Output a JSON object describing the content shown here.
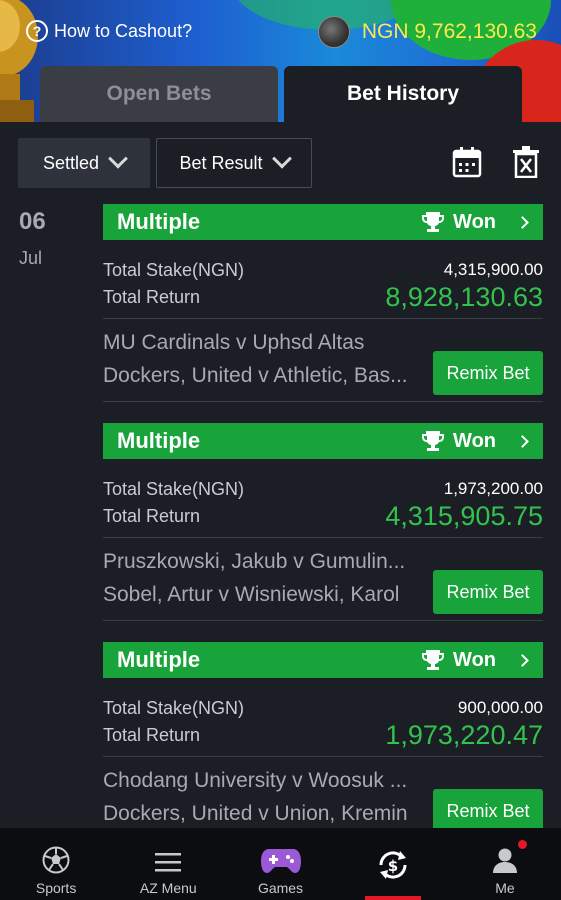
{
  "header": {
    "howto_label": "How to Cashout?",
    "balance": "NGN 9,762,130.63"
  },
  "tabs": [
    {
      "label": "Open Bets",
      "active": false
    },
    {
      "label": "Bet History",
      "active": true
    }
  ],
  "filters": {
    "status": "Settled",
    "result": "Bet Result"
  },
  "date": {
    "day": "06",
    "month": "Jul"
  },
  "bets": [
    {
      "type": "Multiple",
      "status": "Won",
      "stake_label": "Total Stake(NGN)",
      "stake": "4,315,900.00",
      "return_label": "Total Return",
      "return": "8,928,130.63",
      "events": [
        "MU Cardinals v Uphsd Altas",
        "Dockers, United v Athletic, Bas..."
      ],
      "remix_label": "Remix Bet"
    },
    {
      "type": "Multiple",
      "status": "Won",
      "stake_label": "Total Stake(NGN)",
      "stake": "1,973,200.00",
      "return_label": "Total Return",
      "return": "4,315,905.75",
      "events": [
        "Pruszkowski, Jakub v Gumulin...",
        "Sobel, Artur v Wisniewski, Karol"
      ],
      "remix_label": "Remix Bet"
    },
    {
      "type": "Multiple",
      "status": "Won",
      "stake_label": "Total Stake(NGN)",
      "stake": "900,000.00",
      "return_label": "Total Return",
      "return": "1,973,220.47",
      "events": [
        "Chodang University v Woosuk ...",
        "Dockers, United v Union, Kremin"
      ],
      "remix_label": "Remix Bet"
    }
  ],
  "nav": [
    {
      "label": "Sports",
      "icon": "soccer-ball-icon"
    },
    {
      "label": "AZ Menu",
      "icon": "menu-icon"
    },
    {
      "label": "Games",
      "icon": "gamepad-icon"
    },
    {
      "label": "",
      "icon": "cashout-icon",
      "active": true
    },
    {
      "label": "Me",
      "icon": "user-icon"
    }
  ],
  "colors": {
    "accent_green": "#18a33b",
    "return_green": "#33c24d",
    "balance_yellow": "#ffe94a",
    "nav_active_red": "#e41827",
    "background": "#1b1e25"
  }
}
